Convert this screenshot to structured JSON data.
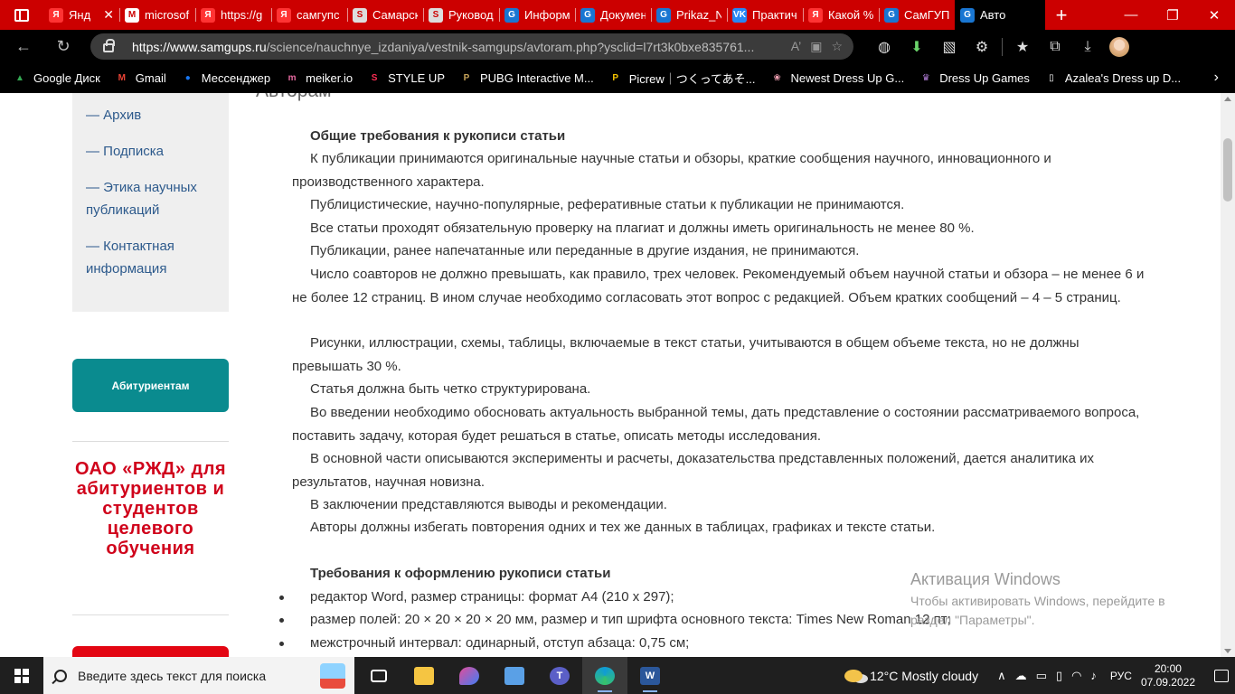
{
  "browser": {
    "tabs": [
      {
        "label": "Янд",
        "icon": "Я",
        "color": "#ff3333",
        "closable": true
      },
      {
        "label": "microsof",
        "icon": "M",
        "color": "#ffffff"
      },
      {
        "label": "https://g",
        "icon": "Я",
        "color": "#ff3333"
      },
      {
        "label": "самгупс",
        "icon": "Я",
        "color": "#ff3333"
      },
      {
        "label": "Самарск",
        "icon": "S",
        "color": "#dddddd"
      },
      {
        "label": "Руковод",
        "icon": "S",
        "color": "#dddddd"
      },
      {
        "label": "Информ",
        "icon": "G",
        "color": "#1976d2"
      },
      {
        "label": "Докумен",
        "icon": "G",
        "color": "#1976d2"
      },
      {
        "label": "Prikaz_N",
        "icon": "G",
        "color": "#1976d2"
      },
      {
        "label": "Практич",
        "icon": "VK",
        "color": "#2787f5"
      },
      {
        "label": "Какой %",
        "icon": "Я",
        "color": "#ff3333"
      },
      {
        "label": "СамГУПС",
        "icon": "G",
        "color": "#1976d2"
      },
      {
        "label": "Авто",
        "icon": "G",
        "color": "#1976d2",
        "active": true
      }
    ],
    "new_tab": "+",
    "url_host": "https://www.samgups.ru",
    "url_path": "/science/nauchnye_izdaniya/vestnik-samgups/avtoram.php?ysclid=l7rt3k0bxe835761...",
    "bookmarks": [
      {
        "label": "Google Диск",
        "color": "#34a853",
        "icon": "▲"
      },
      {
        "label": "Gmail",
        "color": "#ea4335",
        "icon": "M"
      },
      {
        "label": "Мессенджер",
        "color": "#1877f2",
        "icon": "●"
      },
      {
        "label": "meiker.io",
        "color": "#e66aa0",
        "icon": "m"
      },
      {
        "label": "STYLE UP",
        "color": "#ff2d55",
        "icon": "S"
      },
      {
        "label": "PUBG Interactive M...",
        "color": "#c8a45a",
        "icon": "P"
      },
      {
        "label": "Picrew｜つくってあそ...",
        "color": "#f5c400",
        "icon": "P"
      },
      {
        "label": "Newest Dress Up G...",
        "color": "#f4a3b6",
        "icon": "❀"
      },
      {
        "label": "Dress Up Games",
        "color": "#b07cd6",
        "icon": "♛"
      },
      {
        "label": "Azalea's Dress up D...",
        "color": "#ffffff",
        "icon": "▯"
      }
    ]
  },
  "sidebar": {
    "menu": [
      "— Архив",
      "— Подписка",
      "— Этика научных публикаций",
      "— Контактная информация"
    ],
    "abit_button": "Абитуриентам",
    "rzd_text": "ОАО «РЖД» для абитуриентов и студентов целевого обучения"
  },
  "article": {
    "title": "Авторам",
    "heading1": "Общие требования к рукописи статьи",
    "paragraphs": [
      "К публикации принимаются оригинальные научные статьи и обзоры, краткие сообщения научного, инновационного и производственного характера.",
      "Публицистические, научно-популярные, реферативные статьи к публикации не принимаются.",
      "Все статьи проходят обязательную проверку на плагиат и должны иметь оригинальность не менее 80 %.",
      "Публикации, ранее напечатанные или переданные в другие издания, не принимаются.",
      "Число соавторов не должно превышать, как правило, трех человек. Рекомендуемый объем научной статьи и обзора – не менее 6 и не более 12 страниц. В ином случае необходимо согласовать этот вопрос с редакцией. Объем кратких сообщений – 4 – 5 страниц.",
      "Рисунки, иллюстрации, схемы, таблицы, включаемые в текст статьи, учитываются в общем объеме текста, но не должны превышать 30 %.",
      "Статья должна быть четко структурирована.",
      "Во введении необходимо обосновать актуальность выбранной темы, дать представление о состоянии рассматриваемого вопроса, поставить задачу, которая будет решаться в статье, описать методы исследования.",
      "В основной части описываются эксперименты и расчеты, доказательства представленных положений, дается аналитика их результатов, научная новизна.",
      "В заключении представляются выводы и рекомендации.",
      "Авторы должны избегать повторения одних и тех же данных в таблицах, графиках и тексте статьи."
    ],
    "heading2": "Требования к оформлению рукописи статьи",
    "list": [
      "редактор Word, размер страницы: формат А4 (210 х 297);",
      "размер полей: 20 × 20 × 20 × 20 мм, размер и тип шрифта основного текста: Times New Roman 12 пт;",
      "межстрочный интервал: одинарный, отступ абзаца: 0,75 см;"
    ]
  },
  "watermark": {
    "title": "Активация Windows",
    "text": "Чтобы активировать Windows, перейдите в раздел \"Параметры\"."
  },
  "taskbar": {
    "search_placeholder": "Введите здесь текст для поиска",
    "weather": "12°C  Mostly cloudy",
    "lang": "РУС",
    "time": "20:00",
    "date": "07.09.2022"
  }
}
